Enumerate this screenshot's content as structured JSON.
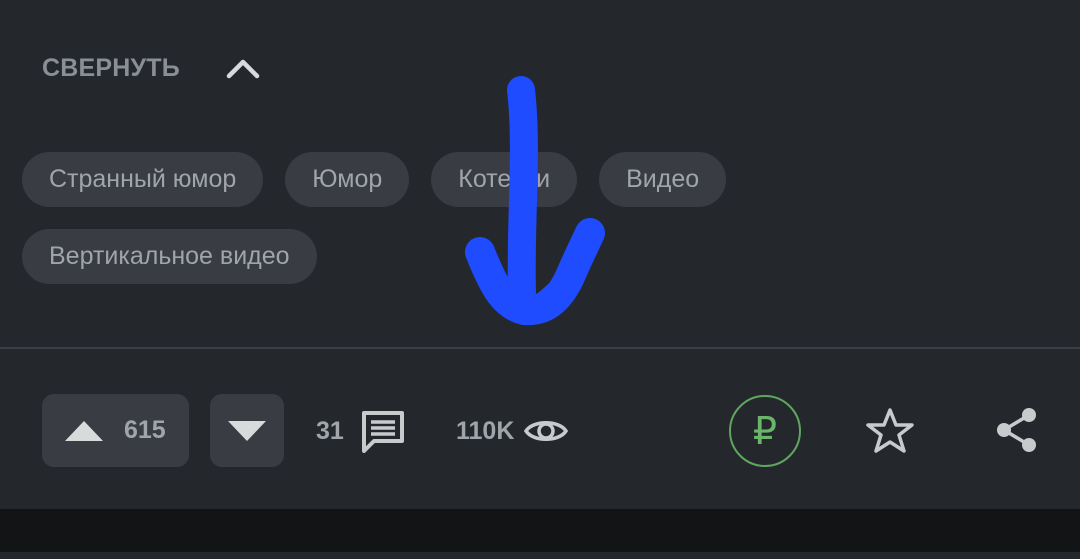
{
  "collapse": {
    "label": "СВЕРНУТЬ",
    "icon": "chevron-up-icon"
  },
  "tags": [
    {
      "label": "Странный юмор"
    },
    {
      "label": "Юмор"
    },
    {
      "label": "Котейки"
    },
    {
      "label": "Видео"
    },
    {
      "label": "Вертикальное видео"
    }
  ],
  "actions": {
    "upvote": {
      "count": "615",
      "icon": "triangle-up-icon"
    },
    "downvote": {
      "icon": "triangle-down-icon"
    },
    "comments": {
      "count": "31",
      "icon": "comment-icon"
    },
    "views": {
      "count": "110K",
      "icon": "eye-icon"
    },
    "donate": {
      "symbol": "₽",
      "icon": "ruble-icon"
    },
    "favorite": {
      "icon": "star-icon"
    },
    "share": {
      "icon": "share-icon"
    }
  },
  "colors": {
    "background": "#24282d",
    "chip": "#393d43",
    "muted_text": "#a0a5aa",
    "donate_green": "#5fa65f",
    "annotation_arrow": "#1f4cff"
  }
}
